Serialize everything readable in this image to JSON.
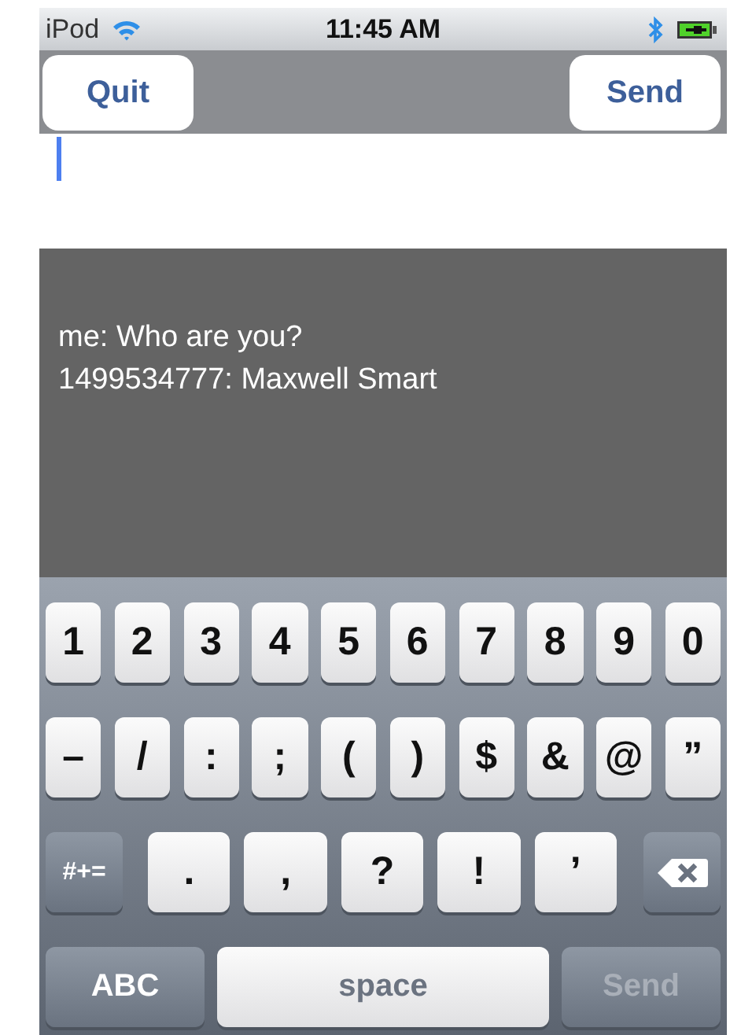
{
  "status_bar": {
    "carrier": "iPod",
    "time": "11:45 AM"
  },
  "nav_bar": {
    "left_button": "Quit",
    "right_button": "Send"
  },
  "message_input": {
    "focused": true
  },
  "messages": [
    {
      "text": "me: Who are you?"
    },
    {
      "text": "1499534777: Maxwell Smart"
    }
  ],
  "keyboard": {
    "rows": [
      {
        "keys": [
          {
            "kind": "char",
            "label": "1"
          },
          {
            "kind": "char",
            "label": "2"
          },
          {
            "kind": "char",
            "label": "3"
          },
          {
            "kind": "char",
            "label": "4"
          },
          {
            "kind": "char",
            "label": "5"
          },
          {
            "kind": "char",
            "label": "6"
          },
          {
            "kind": "char",
            "label": "7"
          },
          {
            "kind": "char",
            "label": "8"
          },
          {
            "kind": "char",
            "label": "9"
          },
          {
            "kind": "char",
            "label": "0"
          }
        ]
      },
      {
        "keys": [
          {
            "kind": "char",
            "label": "–"
          },
          {
            "kind": "char",
            "label": "/"
          },
          {
            "kind": "char",
            "label": ":"
          },
          {
            "kind": "char",
            "label": ";"
          },
          {
            "kind": "char",
            "label": "("
          },
          {
            "kind": "char",
            "label": ")"
          },
          {
            "kind": "char",
            "label": "$"
          },
          {
            "kind": "char",
            "label": "&"
          },
          {
            "kind": "char",
            "label": "@"
          },
          {
            "kind": "char",
            "label": "”"
          }
        ]
      },
      {
        "keys": [
          {
            "kind": "mode",
            "label": "#+="
          },
          {
            "kind": "char",
            "label": "."
          },
          {
            "kind": "char",
            "label": ","
          },
          {
            "kind": "char",
            "label": "?"
          },
          {
            "kind": "char",
            "label": "!"
          },
          {
            "kind": "char",
            "label": "’"
          },
          {
            "kind": "delete"
          }
        ]
      },
      {
        "keys": [
          {
            "kind": "mode",
            "label": "ABC"
          },
          {
            "kind": "space",
            "label": "space"
          },
          {
            "kind": "return",
            "label": "Send",
            "disabled": true
          }
        ]
      }
    ]
  }
}
